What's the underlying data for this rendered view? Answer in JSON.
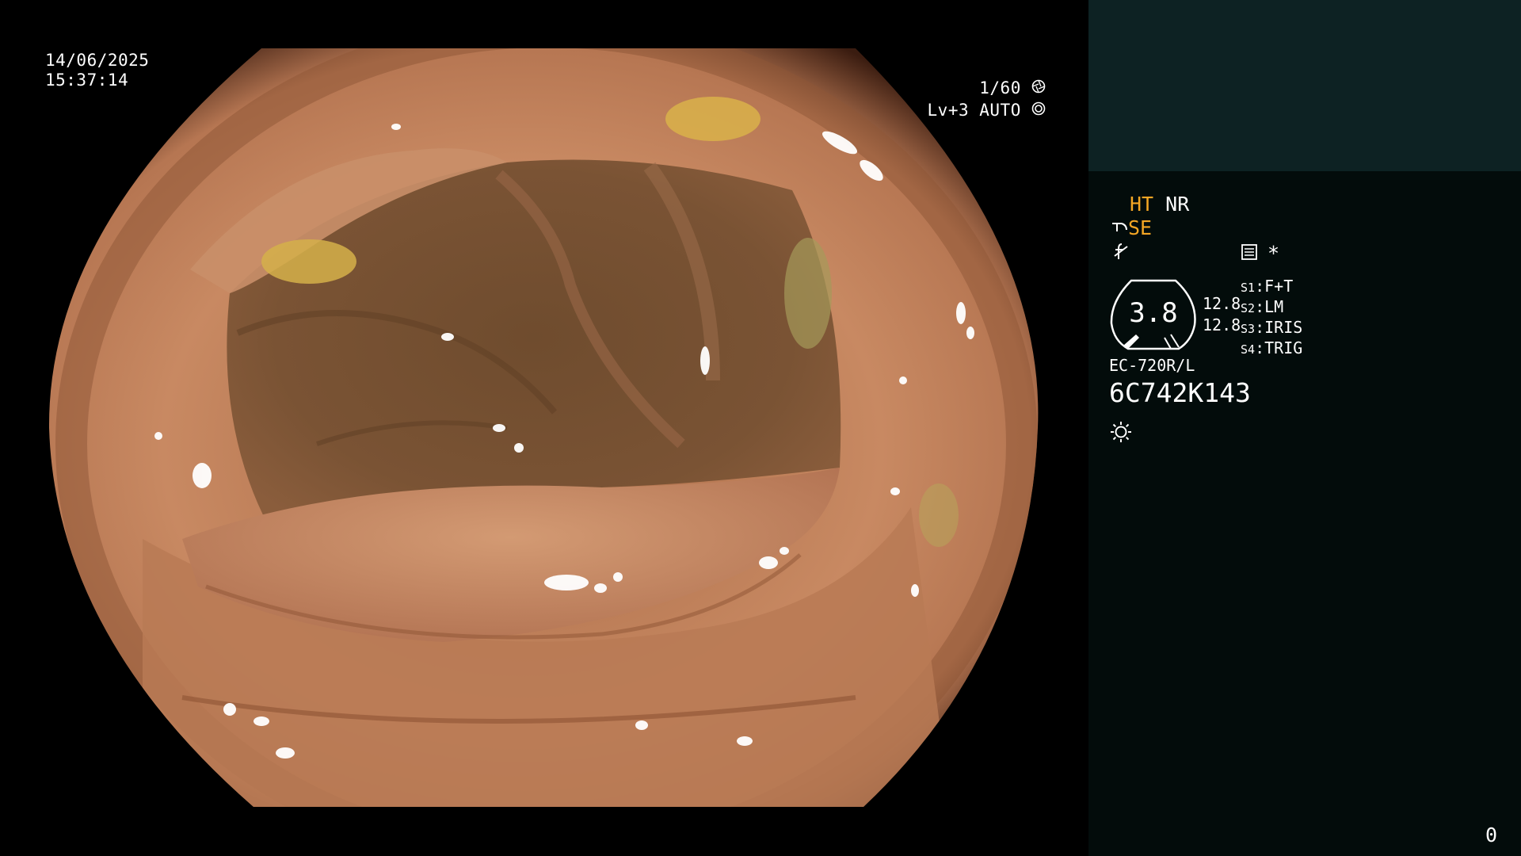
{
  "overlay": {
    "date": "14/06/2025",
    "time": "15:37:14",
    "shutter": "1/60",
    "level": "Lv+3",
    "mode": "AUTO"
  },
  "panel": {
    "ht_label": "HT",
    "nr_label": "NR",
    "se_label": "SE",
    "asterisk": "*",
    "gauge_value": "3.8",
    "gauge_side_1": "12.8",
    "gauge_side_2": "12.8",
    "switches": [
      {
        "key": "S1",
        "value": "F+T"
      },
      {
        "key": "S2",
        "value": "LM"
      },
      {
        "key": "S3",
        "value": "IRIS"
      },
      {
        "key": "S4",
        "value": "TRIG"
      }
    ],
    "model": "EC-720R/L",
    "serial": "6C742K143",
    "counter": "0"
  },
  "colors": {
    "panel_bg": "#030c0b",
    "panel_top_bg": "#0d2223",
    "accent_amber": "#f4a624",
    "mucosa": "#c98a64"
  },
  "icons": {
    "shutter_icon": "aperture-circle",
    "auto_icon": "target-circle",
    "scope_icon": "scope-tip",
    "function_icon": "f-slash",
    "memory_icon": "memory-card",
    "light_icon": "sun"
  }
}
